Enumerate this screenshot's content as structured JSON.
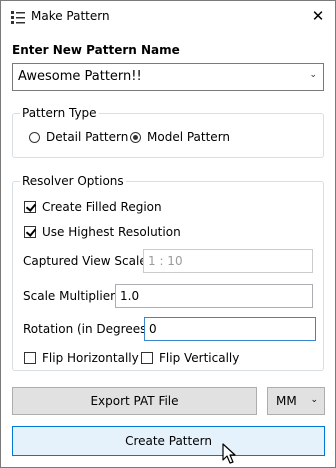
{
  "window": {
    "title": "Make Pattern",
    "close_glyph": "✕"
  },
  "name_section": {
    "label": "Enter New Pattern Name",
    "value": "Awesome Pattern!!"
  },
  "pattern_type": {
    "legend": "Pattern Type",
    "options": [
      {
        "label": "Detail Pattern",
        "selected": false
      },
      {
        "label": "Model Pattern",
        "selected": true
      }
    ]
  },
  "resolver": {
    "legend": "Resolver Options",
    "create_filled_region": {
      "label": "Create Filled Region",
      "checked": true
    },
    "use_highest_resolution": {
      "label": "Use Highest Resolution",
      "checked": true
    },
    "captured_view_scale": {
      "label": "Captured View Scale",
      "value": "1 : 10"
    },
    "scale_multiplier": {
      "label": "Scale Multiplier",
      "value": "1.0"
    },
    "rotation": {
      "label": "Rotation (in Degrees)",
      "value": "0"
    },
    "flip_horizontally": {
      "label": "Flip Horizontally",
      "checked": false
    },
    "flip_vertically": {
      "label": "Flip Vertically",
      "checked": false
    }
  },
  "export_button": {
    "label": "Export PAT File"
  },
  "units_select": {
    "value": "MM"
  },
  "create_button": {
    "label": "Create Pattern"
  },
  "icons": [
    "list-icon",
    "close-icon",
    "chevron-down-icon",
    "cursor-icon"
  ],
  "colors": {
    "accent": "#0078d7",
    "focus_border": "#3b86cf",
    "group_border": "#d5dfe5"
  }
}
